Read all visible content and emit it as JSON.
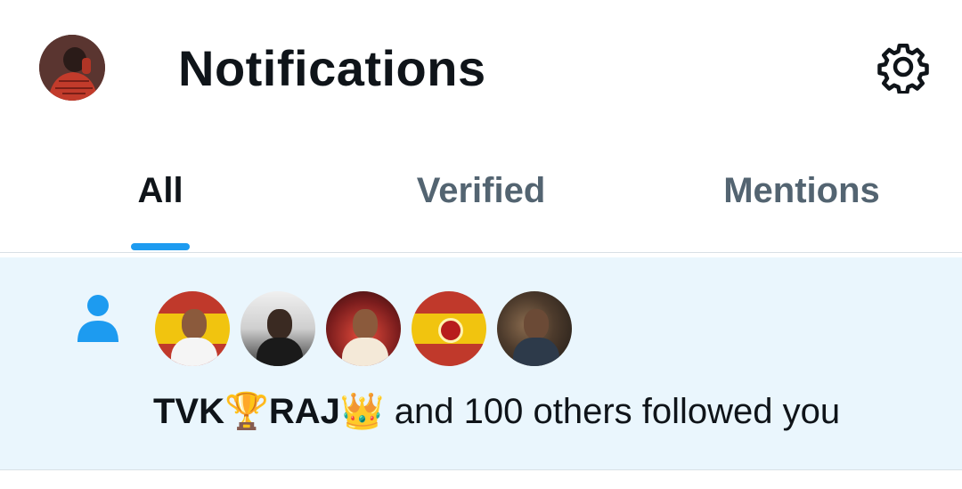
{
  "header": {
    "title": "Notifications",
    "avatar_icon": "user-avatar",
    "settings_icon": "gear-icon"
  },
  "tabs": [
    {
      "label": "All",
      "active": true
    },
    {
      "label": "Verified",
      "active": false
    },
    {
      "label": "Mentions",
      "active": false
    }
  ],
  "notification": {
    "icon": "person-icon",
    "avatars_count_shown": 5,
    "user_name": "TVK",
    "emoji_1": "🏆",
    "user_name_2": "RAJ",
    "emoji_2": "👑",
    "rest_text": " and 100 others followed you"
  },
  "colors": {
    "accent": "#1d9bf0",
    "highlight_bg": "#eaf6fd",
    "text_primary": "#0f1419",
    "text_secondary": "#536471"
  }
}
